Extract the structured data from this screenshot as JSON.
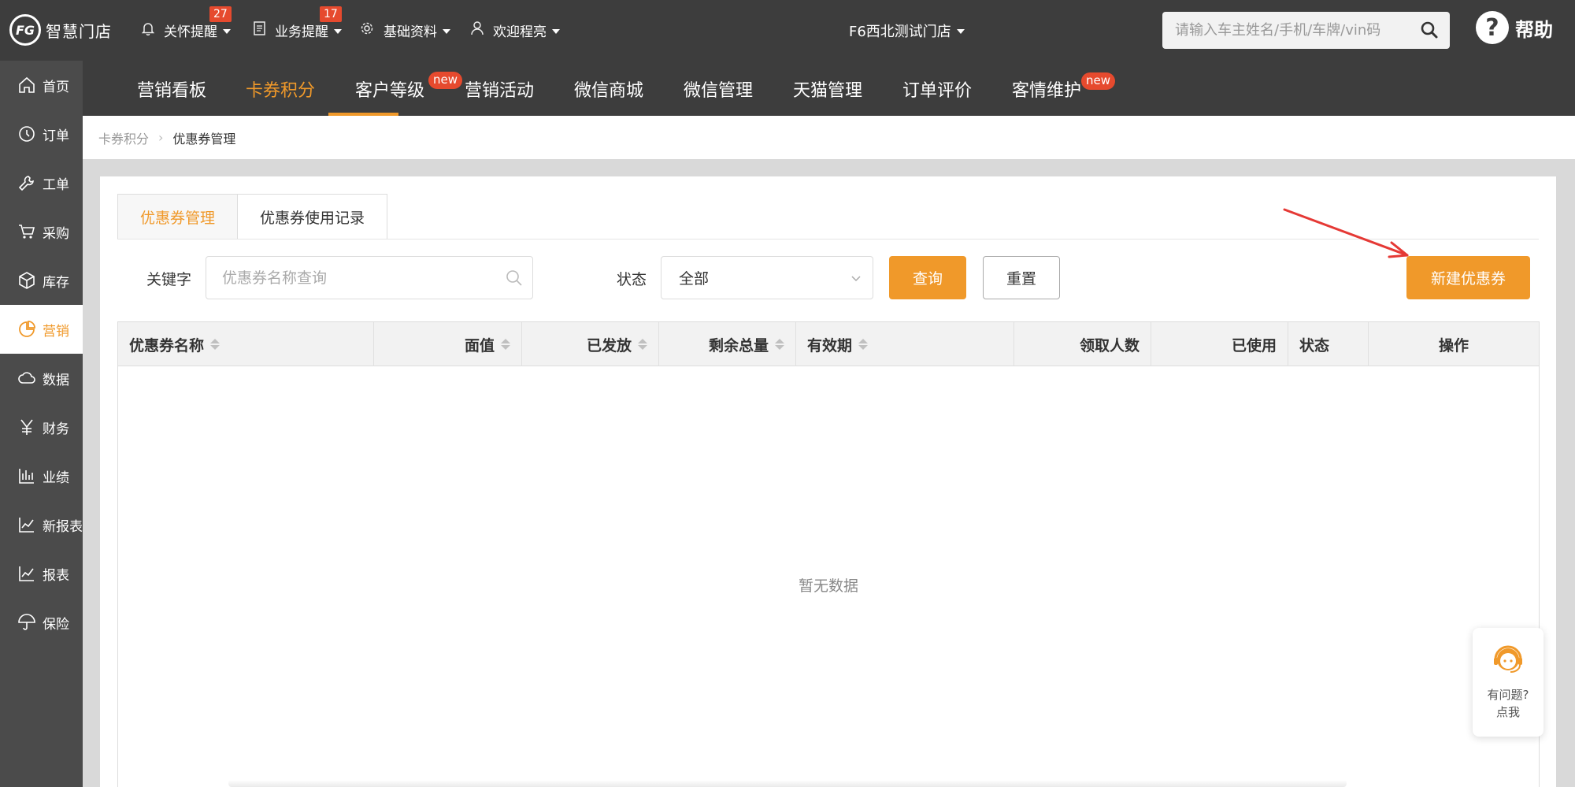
{
  "topbar": {
    "logo_mark": "FG",
    "logo_text": "智慧门店",
    "care_label": "关怀提醒",
    "care_count": "27",
    "biz_label": "业务提醒",
    "biz_count": "17",
    "base_label": "基础资料",
    "user_label": "欢迎程亮",
    "store_label": "F6西北测试门店",
    "search_placeholder": "请输入车主姓名/手机/车牌/vin码",
    "help_label": "帮助"
  },
  "sidebar": {
    "items": [
      {
        "label": "首页",
        "icon": "home-icon"
      },
      {
        "label": "订单",
        "icon": "clock-icon"
      },
      {
        "label": "工单",
        "icon": "wrench-icon"
      },
      {
        "label": "采购",
        "icon": "cart-icon"
      },
      {
        "label": "库存",
        "icon": "box-icon"
      },
      {
        "label": "营销",
        "icon": "pie-icon"
      },
      {
        "label": "数据",
        "icon": "cloud-icon"
      },
      {
        "label": "财务",
        "icon": "yen-icon"
      },
      {
        "label": "业绩",
        "icon": "bar-chart-icon"
      },
      {
        "label": "新报表",
        "icon": "line-chart-icon"
      },
      {
        "label": "报表",
        "icon": "line-chart-icon"
      },
      {
        "label": "保险",
        "icon": "umbrella-icon"
      }
    ],
    "active_index": 5
  },
  "subnav": {
    "items": [
      "营销看板",
      "卡券积分",
      "客户等级",
      "营销活动",
      "微信商城",
      "微信管理",
      "天猫管理",
      "订单评价",
      "客情维护"
    ],
    "new_badge": "new",
    "active": "卡券积分"
  },
  "breadcrumb": {
    "parent": "卡券积分",
    "separator": ">",
    "current": "优惠券管理"
  },
  "tabs": [
    "优惠券管理",
    "优惠券使用记录"
  ],
  "filters": {
    "keyword_label": "关键字",
    "keyword_placeholder": "优惠券名称查询",
    "status_label": "状态",
    "status_value": "全部",
    "query_button": "查询",
    "reset_button": "重置",
    "new_button": "新建优惠券"
  },
  "table": {
    "columns": [
      "优惠券名称",
      "面值",
      "已发放",
      "剩余总量",
      "有效期",
      "领取人数",
      "已使用",
      "状态",
      "操作"
    ],
    "empty_text": "暂无数据"
  },
  "helper": {
    "line1": "有问题?",
    "line2": "点我"
  },
  "colors": {
    "accent": "#f0992a",
    "topbar": "#3d3d3d",
    "sidebar": "#4b4b4b",
    "badge": "#e64a2e"
  }
}
